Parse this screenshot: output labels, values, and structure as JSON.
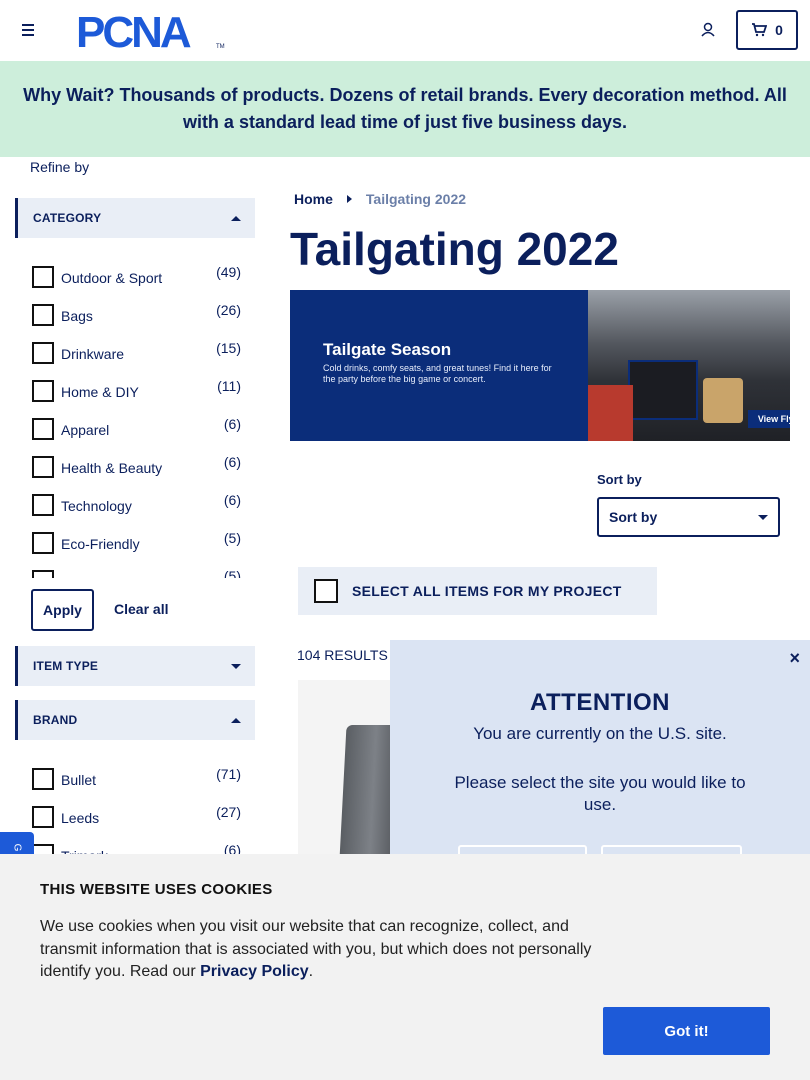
{
  "header": {
    "logo_text": "PCNA",
    "logo_tm": "TM",
    "cart_count": "0"
  },
  "promo": {
    "text": "Why Wait? Thousands of products. Dozens of retail brands. Every decoration method. All with a standard lead time of just five business days."
  },
  "sidebar": {
    "refine_label": "Refine by",
    "category": {
      "title": "CATEGORY",
      "items": [
        {
          "label": "Outdoor & Sport",
          "count": "(49)"
        },
        {
          "label": "Bags",
          "count": "(26)"
        },
        {
          "label": "Drinkware",
          "count": "(15)"
        },
        {
          "label": "Home & DIY",
          "count": "(11)"
        },
        {
          "label": "Apparel",
          "count": "(6)"
        },
        {
          "label": "Health & Beauty",
          "count": "(6)"
        },
        {
          "label": "Technology",
          "count": "(6)"
        },
        {
          "label": "Eco-Friendly",
          "count": "(5)"
        },
        {
          "label": "",
          "count": "(5)"
        }
      ],
      "apply_label": "Apply",
      "clear_label": "Clear all"
    },
    "item_type": {
      "title": "ITEM TYPE"
    },
    "brand": {
      "title": "BRAND",
      "items": [
        {
          "label": "Bullet",
          "count": "(71)"
        },
        {
          "label": "Leeds",
          "count": "(27)"
        },
        {
          "label": "Trimark",
          "count": "(6)"
        }
      ]
    },
    "side_tab": "G"
  },
  "main": {
    "breadcrumb": {
      "home": "Home",
      "current": "Tailgating 2022"
    },
    "title": "Tailgating 2022",
    "hero": {
      "title": "Tailgate Season",
      "subtitle": "Cold drinks, comfy seats, and great tunes! Find it here for the party before the big game or concert.",
      "flyer_label": "View Flyer"
    },
    "sort": {
      "label": "Sort by",
      "value": "Sort by"
    },
    "select_all_label": "SELECT ALL ITEMS FOR MY PROJECT",
    "results": "104 RESULTS"
  },
  "attention": {
    "close": "×",
    "title": "ATTENTION",
    "line1": "You are currently on the U.S. site.",
    "line2": "Please select the site you would like to use."
  },
  "cookie": {
    "title": "THIS WEBSITE USES COOKIES",
    "text_before": "We use cookies when you visit our website that can recognize, collect, and transmit information that is associated with you, but which does not personally identify you. Read our ",
    "link": "Privacy Policy",
    "text_after": ".",
    "button": "Got it!"
  },
  "colors": {
    "brand_navy": "#0b1f5c",
    "promo_bg": "#cdeedb",
    "accent_blue": "#1d5ad8",
    "facet_bg": "#e9eef6"
  }
}
